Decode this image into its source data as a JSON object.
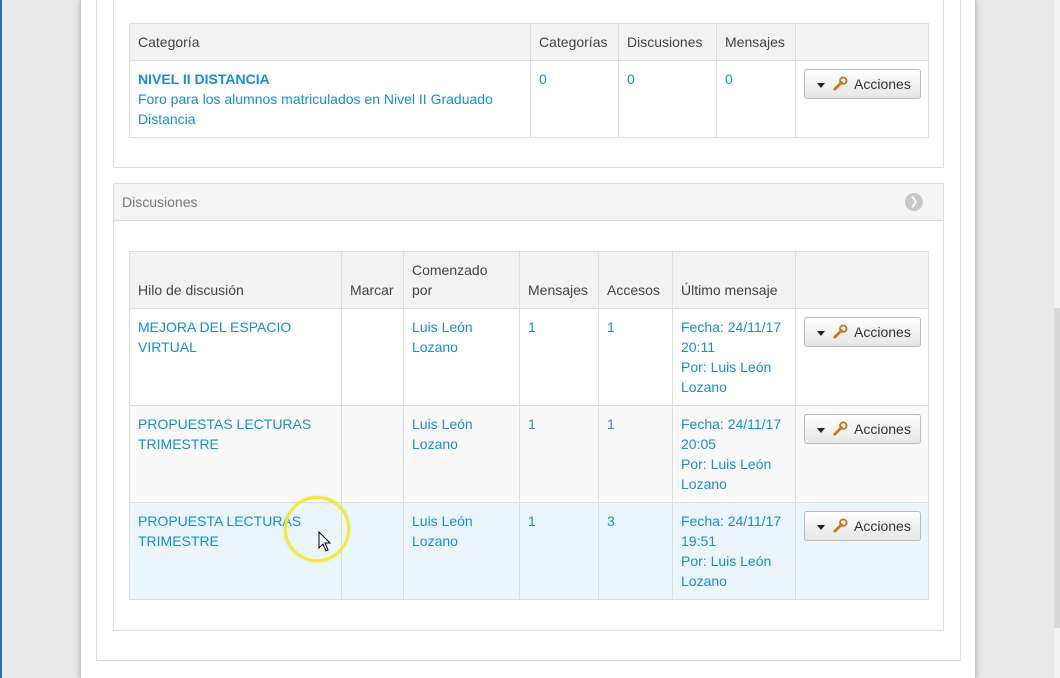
{
  "categories_table": {
    "headers": [
      "Categoría",
      "Categorías",
      "Discusiones",
      "Mensajes",
      ""
    ],
    "row": {
      "title": "NIVEL II DISTANCIA",
      "description": "Foro para los alumnos matriculados en Nivel II Graduado Distancia",
      "categorias": "0",
      "discusiones": "0",
      "mensajes": "0",
      "action": "Acciones"
    }
  },
  "discussions_panel": {
    "title": "Discusiones",
    "headers": [
      "Hilo de discusión",
      "Marcar",
      "Comenzado por",
      "Mensajes",
      "Accesos",
      "Último mensaje",
      ""
    ],
    "rows": [
      {
        "thread": "MEJORA DEL ESPACIO VIRTUAL",
        "started_by": "Luis León Lozano",
        "mensajes": "1",
        "accesos": "1",
        "last_date": "Fecha: 24/11/17 20:11",
        "last_by": "Por: Luis León Lozano",
        "action": "Acciones"
      },
      {
        "thread": "PROPUESTAS LECTURAS TRIMESTRE",
        "started_by": "Luis León Lozano",
        "mensajes": "1",
        "accesos": "1",
        "last_date": "Fecha: 24/11/17 20:05",
        "last_by": "Por: Luis León Lozano",
        "action": "Acciones"
      },
      {
        "thread": "PROPUESTA LECTURAS TRIMESTRE",
        "started_by": "Luis León Lozano",
        "mensajes": "1",
        "accesos": "3",
        "last_date": "Fecha: 24/11/17 19:51",
        "last_by": "Por: Luis León Lozano",
        "action": "Acciones"
      }
    ]
  },
  "colors": {
    "link": "#1a8cd8",
    "highlight_ring": "#f2ea35",
    "row_hover": "#eaf5fc"
  },
  "icons": {
    "dropdown": "caret-down-icon",
    "action": "wrench-icon",
    "collapse": "chevron-down-circle-icon"
  }
}
